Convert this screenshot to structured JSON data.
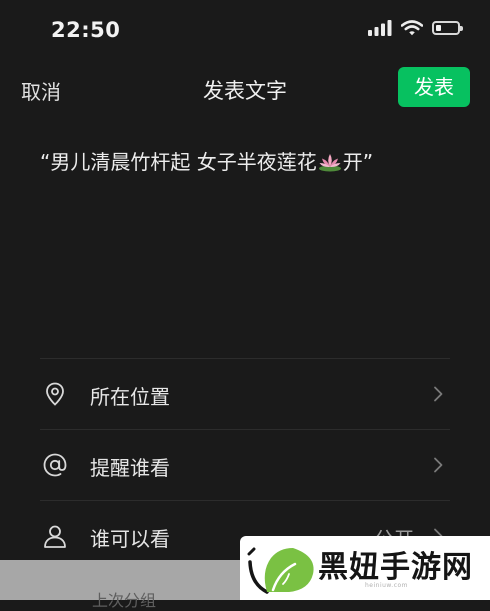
{
  "status_bar": {
    "time": "22:50",
    "icons": [
      "signal-icon",
      "wifi-icon",
      "battery-icon"
    ],
    "battery_level": 0.22
  },
  "nav": {
    "cancel_label": "取消",
    "title": "发表文字",
    "publish_label": "发表"
  },
  "post": {
    "text_before": "“男儿清晨竹杆起 女子半夜莲花",
    "emoji": "lotus-icon",
    "text_after": "开”"
  },
  "options": [
    {
      "icon": "location-pin-icon",
      "label": "所在位置",
      "value": ""
    },
    {
      "icon": "at-mention-icon",
      "label": "提醒谁看",
      "value": ""
    },
    {
      "icon": "user-icon",
      "label": "谁可以看",
      "value": "公开"
    }
  ],
  "bottom_strip": {
    "text": "上次分组"
  },
  "watermark": {
    "text": "黑妞手游网",
    "subtext": "heiniuw.com"
  },
  "colors": {
    "background": "#1a1a1a",
    "accent": "#07c160",
    "text": "#e8e8e8",
    "muted": "#9a9a9a"
  }
}
